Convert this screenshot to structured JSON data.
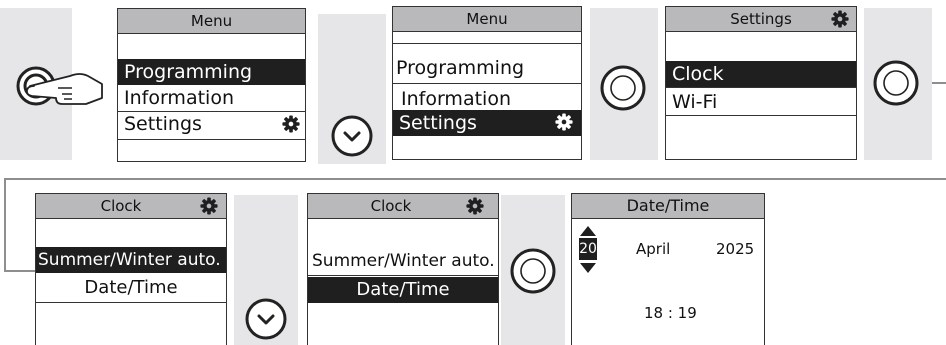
{
  "panel1": {
    "title": "Menu",
    "items": [
      "Programming",
      "Information",
      "Settings"
    ],
    "selected": 0,
    "settings_icon": "gear-icon"
  },
  "panel2": {
    "title": "Menu",
    "items": [
      "Programming",
      "Information",
      "Settings"
    ],
    "selected": 2,
    "settings_icon": "gear-icon"
  },
  "panel3": {
    "title": "Settings",
    "items": [
      "Clock",
      "Wi-Fi"
    ],
    "selected": 0,
    "title_icon": "gear-icon"
  },
  "panel4": {
    "title": "Clock",
    "items": [
      "Summer/Winter auto.",
      "Date/Time"
    ],
    "selected": 0,
    "title_icon": "gear-icon"
  },
  "panel5": {
    "title": "Clock",
    "items": [
      "Summer/Winter auto.",
      "Date/Time"
    ],
    "selected": 1,
    "title_icon": "gear-icon"
  },
  "panel6": {
    "title": "Date/Time",
    "day": "20",
    "month": "April",
    "year": "2025",
    "time": "18 : 19",
    "spinner_icons": [
      "arrow-up-icon",
      "arrow-down-icon"
    ]
  },
  "steps": {
    "press_icon": "hand-press-button-icon",
    "down_icon": "chevron-down-button-icon",
    "ok_icon": "ok-ring-button-icon"
  }
}
